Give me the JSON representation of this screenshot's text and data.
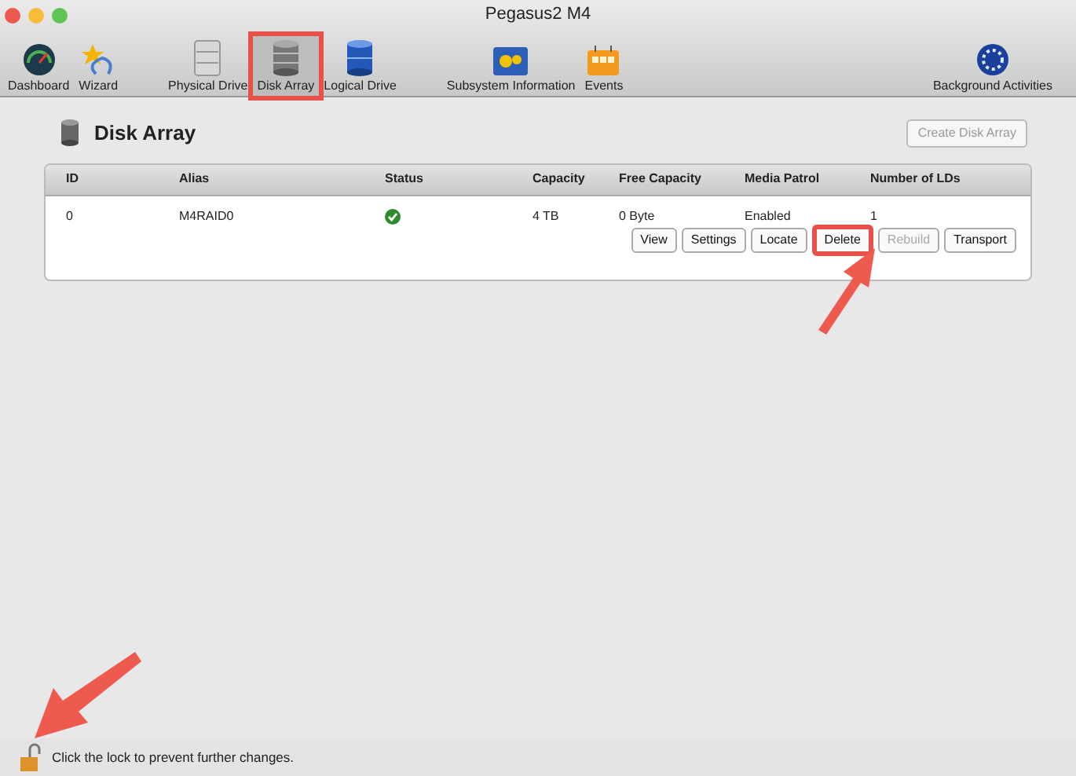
{
  "window": {
    "title": "Pegasus2 M4"
  },
  "toolbar": {
    "left": [
      {
        "label": "Dashboard",
        "kind": "gauge",
        "selected": false,
        "highlighted": false
      },
      {
        "label": "Wizard",
        "kind": "wand",
        "selected": false,
        "highlighted": false
      },
      {
        "label": "Physical Drive",
        "kind": "drive",
        "selected": false,
        "highlighted": false
      },
      {
        "label": "Disk Array",
        "kind": "array",
        "selected": true,
        "highlighted": true
      },
      {
        "label": "Logical Drive",
        "kind": "logical",
        "selected": false,
        "highlighted": false
      },
      {
        "label": "Subsystem Information",
        "kind": "info",
        "selected": false,
        "highlighted": false
      },
      {
        "label": "Events",
        "kind": "events",
        "selected": false,
        "highlighted": false
      }
    ],
    "right": [
      {
        "label": "Background Activities",
        "kind": "globe",
        "selected": false,
        "highlighted": false
      }
    ]
  },
  "page": {
    "title": "Disk Array",
    "create_button": {
      "label": "Create Disk Array",
      "disabled": true
    }
  },
  "table": {
    "columns": [
      "ID",
      "Alias",
      "Status",
      "Capacity",
      "Free Capacity",
      "Media Patrol",
      "Number of LDs"
    ],
    "rows": [
      {
        "id": "0",
        "alias": "M4RAID0",
        "healthy": true,
        "capacity": "4 TB",
        "free_capacity": "0 Byte",
        "media_patrol": "Enabled",
        "lds": "1",
        "actions": [
          {
            "label": "View",
            "disabled": false,
            "highlighted": false
          },
          {
            "label": "Settings",
            "disabled": false,
            "highlighted": false
          },
          {
            "label": "Locate",
            "disabled": false,
            "highlighted": false
          },
          {
            "label": "Delete",
            "disabled": false,
            "highlighted": true
          },
          {
            "label": "Rebuild",
            "disabled": true,
            "highlighted": false
          },
          {
            "label": "Transport",
            "disabled": false,
            "highlighted": false
          }
        ]
      }
    ]
  },
  "status_bar": {
    "text": "Click the lock to prevent further changes.",
    "locked": false
  }
}
